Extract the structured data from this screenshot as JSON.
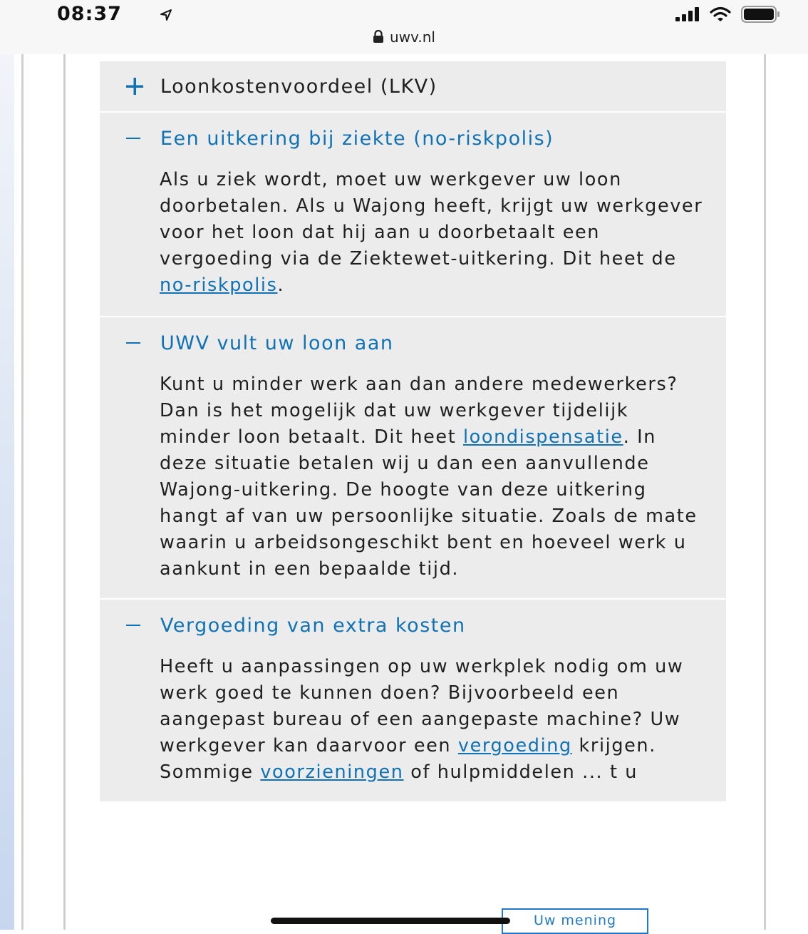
{
  "status": {
    "time": "08:37",
    "url": "uwv.nl"
  },
  "icons": {
    "location": "location-arrow-icon",
    "signal": "cellular-signal-icon",
    "wifi": "wifi-icon",
    "battery": "battery-icon",
    "lock": "lock-icon",
    "expand": "plus-icon",
    "collapse": "minus-icon"
  },
  "colors": {
    "link": "#0f72b5",
    "panel": "#ececec"
  },
  "accordion": [
    {
      "title": "Loonkostenvoordeel (LKV)",
      "expanded": false
    },
    {
      "title": "Een uitkering bij ziekte (no-riskpolis)",
      "expanded": true,
      "body_before": "Als u ziek wordt, moet uw werkgever uw loon doorbetalen. Als u Wajong heeft, krijgt uw werkgever voor het loon dat hij aan u doorbetaalt een vergoeding via de Ziektewet-uitkering. Dit heet de ",
      "link": "no-riskpolis",
      "body_after": "."
    },
    {
      "title": "UWV vult uw loon aan",
      "expanded": true,
      "body_before": "Kunt u minder werk aan dan andere medewerkers? Dan is het mogelijk dat uw werkgever tijdelijk minder loon betaalt. Dit heet ",
      "link": "loondispensatie",
      "body_after": ". In deze situatie betalen wij u dan een aanvullende Wajong-uitkering. De hoogte van deze uitkering hangt af van uw persoonlijke situatie. Zoals de mate waarin u arbeidsongeschikt bent en hoeveel werk u aankunt in een bepaalde tijd."
    },
    {
      "title": "Vergoeding van extra kosten",
      "expanded": true,
      "body_before": "Heeft u aanpassingen op uw werkplek nodig om uw werk goed te kunnen doen? Bijvoorbeeld een aangepast bureau of een aangepaste machine? Uw werkgever kan daarvoor een ",
      "link": "vergoeding",
      "body_mid": " krijgen. Sommige ",
      "link2": "voorzieningen",
      "body_after": " of hulpmiddelen ... t u"
    }
  ],
  "feedback": {
    "label": "Uw mening"
  }
}
